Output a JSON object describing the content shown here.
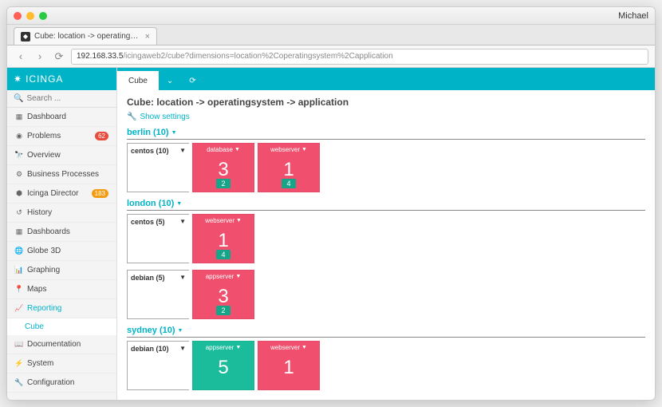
{
  "titlebar": {
    "user": "Michael"
  },
  "browser_tab": {
    "title": "Cube: location -> operatingsys"
  },
  "address": {
    "host": "192.168.33.5",
    "path": "/icingaweb2/cube?dimensions=location%2Coperatingsystem%2Capplication"
  },
  "brand": "ICINGA",
  "search": {
    "placeholder": "Search ..."
  },
  "nav": {
    "dashboard": "Dashboard",
    "problems": "Problems",
    "problems_badge": "62",
    "overview": "Overview",
    "business": "Business Processes",
    "director": "Icinga Director",
    "director_badge": "183",
    "history": "History",
    "dashboards": "Dashboards",
    "globe": "Globe 3D",
    "graphing": "Graphing",
    "maps": "Maps",
    "reporting": "Reporting",
    "cube": "Cube",
    "documentation": "Documentation",
    "system": "System",
    "configuration": "Configuration"
  },
  "top_tabs": {
    "cube": "Cube"
  },
  "page": {
    "title": "Cube: location -> operatingsystem -> application",
    "show_settings": "Show settings"
  },
  "sections": [
    {
      "header": "berlin (10)",
      "rows": [
        {
          "os": "centos (10)",
          "tiles": [
            {
              "label": "database",
              "value": "3",
              "badge": "2",
              "color": "red"
            },
            {
              "label": "webserver",
              "value": "1",
              "badge": "4",
              "color": "red"
            }
          ]
        }
      ]
    },
    {
      "header": "london (10)",
      "rows": [
        {
          "os": "centos (5)",
          "tiles": [
            {
              "label": "webserver",
              "value": "1",
              "badge": "4",
              "color": "red"
            }
          ]
        },
        {
          "os": "debian (5)",
          "tiles": [
            {
              "label": "appserver",
              "value": "3",
              "badge": "2",
              "color": "red"
            }
          ]
        }
      ]
    },
    {
      "header": "sydney (10)",
      "rows": [
        {
          "os": "debian (10)",
          "tiles": [
            {
              "label": "appserver",
              "value": "5",
              "badge": "",
              "color": "green"
            },
            {
              "label": "webserver",
              "value": "1",
              "badge": "",
              "color": "red"
            }
          ]
        }
      ]
    }
  ]
}
